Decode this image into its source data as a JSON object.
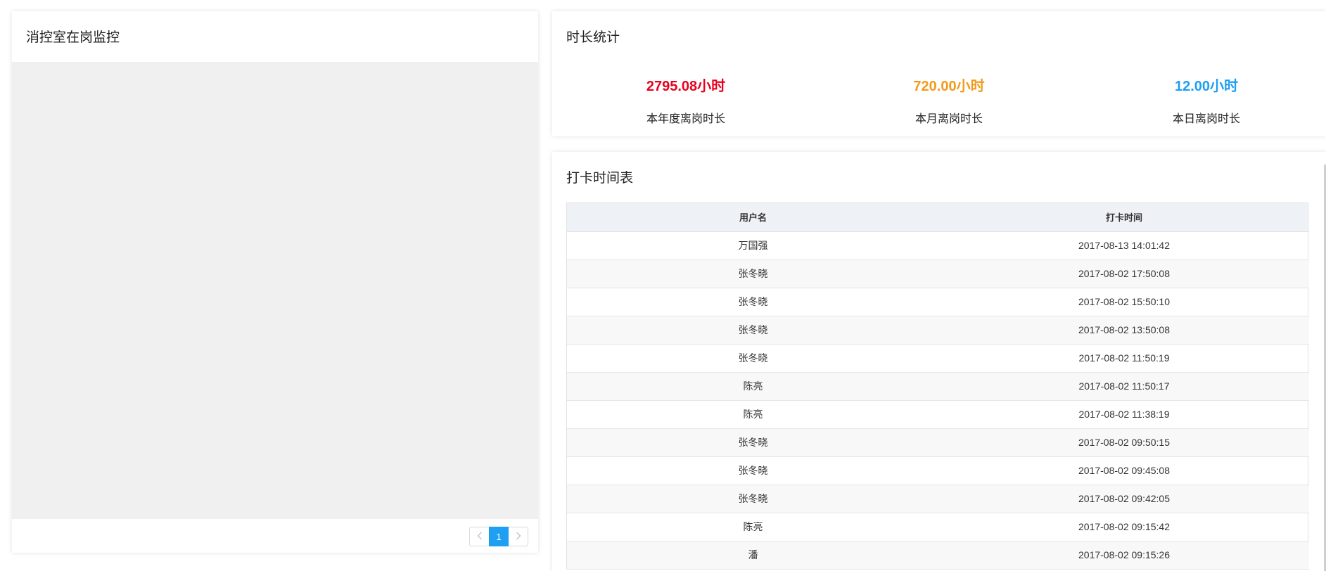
{
  "monitor": {
    "title": "消控室在岗监控",
    "pagination": {
      "current_page": "1",
      "prev_icon": "chevron-left-icon",
      "next_icon": "chevron-right-icon"
    }
  },
  "stats": {
    "title": "时长统计",
    "items": [
      {
        "value": "2795.08小时",
        "label": "本年度离岗时长",
        "color": "#e8001e"
      },
      {
        "value": "720.00小时",
        "label": "本月离岗时长",
        "color": "#f39a1c"
      },
      {
        "value": "12.00小时",
        "label": "本日离岗时长",
        "color": "#1e9ff2"
      }
    ]
  },
  "checkin": {
    "title": "打卡时间表",
    "columns": [
      "用户名",
      "打卡时间"
    ],
    "rows": [
      [
        "万国强",
        "2017-08-13 14:01:42"
      ],
      [
        "张冬晓",
        "2017-08-02 17:50:08"
      ],
      [
        "张冬晓",
        "2017-08-02 15:50:10"
      ],
      [
        "张冬晓",
        "2017-08-02 13:50:08"
      ],
      [
        "张冬晓",
        "2017-08-02 11:50:19"
      ],
      [
        "陈亮",
        "2017-08-02 11:50:17"
      ],
      [
        "陈亮",
        "2017-08-02 11:38:19"
      ],
      [
        "张冬晓",
        "2017-08-02 09:50:15"
      ],
      [
        "张冬晓",
        "2017-08-02 09:45:08"
      ],
      [
        "张冬晓",
        "2017-08-02 09:42:05"
      ],
      [
        "陈亮",
        "2017-08-02 09:15:42"
      ],
      [
        "潘",
        "2017-08-02 09:15:26"
      ]
    ]
  },
  "colors": {
    "accent": "#1e9ff2",
    "header_bg": "#eef1f6",
    "video_bg": "#f0f0f0"
  }
}
